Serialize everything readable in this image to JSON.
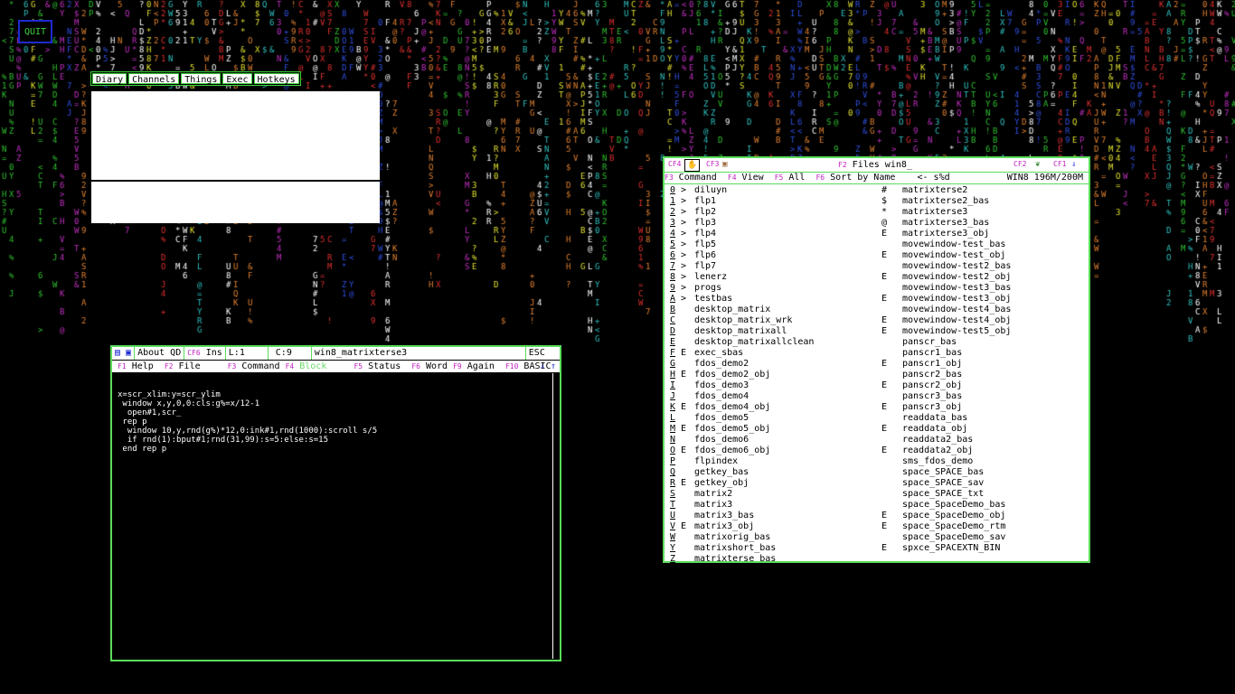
{
  "quit_label": "QUIT",
  "qd_menu": [
    "Diary",
    "Channels",
    "Things",
    "Exec",
    "Hotkeys"
  ],
  "editor": {
    "title": {
      "about": "About QD",
      "ins_key": "CF6",
      "ins": "Ins",
      "line": "L:1",
      "col": "C:9",
      "filename": "win8_matrixterse3",
      "esc": "ESC"
    },
    "fkeys": [
      {
        "key": "F1",
        "label": "Help"
      },
      {
        "key": "F2",
        "label": "File"
      },
      {
        "key": "F3",
        "label": "Command"
      },
      {
        "key": "F4",
        "label": "Block"
      },
      {
        "key": "F5",
        "label": "Status"
      },
      {
        "key": "F6",
        "label": "Word"
      },
      {
        "key": "F9",
        "label": "Again"
      },
      {
        "key": "F10",
        "label": "BASIC"
      }
    ],
    "code": [
      "x=scr_xlim:y=scr_ylim",
      " window x,y,0,0:cls:g%=x/12-1",
      "  open#1,scr_",
      "",
      " rep p",
      "  window 10,y,rnd(g%)*12,0:ink#1,rnd(1000):scroll s/5",
      "  if rnd(1):bput#1;rnd(31,99):s=5:else:s=15",
      " end rep p"
    ]
  },
  "files": {
    "title_key": "F2",
    "title": "Files win8_",
    "cf_left": [
      "CF4",
      "CF3"
    ],
    "cf_right": [
      "CF2",
      "CF1"
    ],
    "menu": [
      {
        "key": "F3",
        "label": "Command"
      },
      {
        "key": "F4",
        "label": "View"
      },
      {
        "key": "F5",
        "label": "All"
      },
      {
        "key": "F6",
        "label": "Sort by Name"
      }
    ],
    "path_hint": "<- s%d",
    "device": "WIN8 196M/200M",
    "left": [
      {
        "k": "0",
        "m": ">",
        "n": "diluyn"
      },
      {
        "k": "1",
        "m": ">",
        "n": "flp1"
      },
      {
        "k": "2",
        "m": ">",
        "n": "flp2"
      },
      {
        "k": "3",
        "m": ">",
        "n": "flp3"
      },
      {
        "k": "4",
        "m": ">",
        "n": "flp4"
      },
      {
        "k": "5",
        "m": ">",
        "n": "flp5"
      },
      {
        "k": "6",
        "m": ">",
        "n": "flp6"
      },
      {
        "k": "7",
        "m": ">",
        "n": "flp7"
      },
      {
        "k": "8",
        "m": ">",
        "n": "lenerz"
      },
      {
        "k": "9",
        "m": ">",
        "n": "progs"
      },
      {
        "k": "A",
        "m": ">",
        "n": "testbas"
      },
      {
        "k": "B",
        "m": "",
        "n": "desktop_matrix"
      },
      {
        "k": "C",
        "m": "",
        "n": "desktop_matrix_wrk"
      },
      {
        "k": "D",
        "m": "",
        "n": "desktop_matrixall"
      },
      {
        "k": "E",
        "m": "",
        "n": "desktop_matrixallclean"
      },
      {
        "k": "F",
        "m": "E",
        "n": "exec_sbas"
      },
      {
        "k": "G",
        "m": "",
        "n": "fdos_demo2"
      },
      {
        "k": "H",
        "m": "E",
        "n": "fdos_demo2_obj"
      },
      {
        "k": "I",
        "m": "",
        "n": "fdos_demo3"
      },
      {
        "k": "J",
        "m": "",
        "n": "fdos_demo4"
      },
      {
        "k": "K",
        "m": "E",
        "n": "fdos_demo4_obj"
      },
      {
        "k": "L",
        "m": "",
        "n": "fdos_demo5"
      },
      {
        "k": "M",
        "m": "E",
        "n": "fdos_demo5_obj"
      },
      {
        "k": "N",
        "m": "",
        "n": "fdos_demo6"
      },
      {
        "k": "O",
        "m": "E",
        "n": "fdos_demo6_obj"
      },
      {
        "k": "P",
        "m": "",
        "n": "flpindex"
      },
      {
        "k": "Q",
        "m": "",
        "n": "getkey_bas"
      },
      {
        "k": "R",
        "m": "E",
        "n": "getkey_obj"
      },
      {
        "k": "S",
        "m": "",
        "n": "matrix2"
      },
      {
        "k": "T",
        "m": "",
        "n": "matrix3"
      },
      {
        "k": "U",
        "m": "",
        "n": "matrix3_bas"
      },
      {
        "k": "V",
        "m": "E",
        "n": "matrix3_obj"
      },
      {
        "k": "W",
        "m": "",
        "n": "matrixorig_bas"
      },
      {
        "k": "Y",
        "m": "",
        "n": "matrixshort_bas"
      },
      {
        "k": "Z",
        "m": "",
        "n": "matrixterse_bas"
      }
    ],
    "right": [
      {
        "k": "#",
        "n": "matrixterse2"
      },
      {
        "k": "$",
        "n": "matrixterse2_bas"
      },
      {
        "k": "*",
        "n": "matrixterse3"
      },
      {
        "k": "@",
        "n": "matrixterse3_bas"
      },
      {
        "k": "E",
        "n": "matrixterse3_obj"
      },
      {
        "k": "",
        "n": "movewindow-test_bas"
      },
      {
        "k": "E",
        "n": "movewindow-test_obj"
      },
      {
        "k": "",
        "n": "movewindow-test2_bas"
      },
      {
        "k": "E",
        "n": "movewindow-test2_obj"
      },
      {
        "k": "",
        "n": "movewindow-test3_bas"
      },
      {
        "k": "E",
        "n": "movewindow-test3_obj"
      },
      {
        "k": "",
        "n": "movewindow-test4_bas"
      },
      {
        "k": "E",
        "n": "movewindow-test4_obj"
      },
      {
        "k": "E",
        "n": "movewindow-test5_obj"
      },
      {
        "k": "",
        "n": "panscr_bas"
      },
      {
        "k": "",
        "n": "panscr1_bas"
      },
      {
        "k": "E",
        "n": "panscr1_obj"
      },
      {
        "k": "",
        "n": "panscr2_bas"
      },
      {
        "k": "E",
        "n": "panscr2_obj"
      },
      {
        "k": "",
        "n": "panscr3_bas"
      },
      {
        "k": "E",
        "n": "panscr3_obj"
      },
      {
        "k": "",
        "n": "readdata_bas"
      },
      {
        "k": "E",
        "n": "readdata_obj"
      },
      {
        "k": "",
        "n": "readdata2_bas"
      },
      {
        "k": "E",
        "n": "readdata2_obj"
      },
      {
        "k": "",
        "n": "sms_fdos_demo"
      },
      {
        "k": "",
        "n": "space_SPACE_bas"
      },
      {
        "k": "",
        "n": "space_SPACE_sav"
      },
      {
        "k": "",
        "n": "space_SPACE_txt"
      },
      {
        "k": "",
        "n": "space_SpaceDemo_bas"
      },
      {
        "k": "E",
        "n": "space_SpaceDemo_obj"
      },
      {
        "k": "E",
        "n": "space_SpaceDemo_rtm"
      },
      {
        "k": "",
        "n": "space_SpaceDemo_sav"
      },
      {
        "k": "E",
        "n": "spxce_SPACEXTN_BIN"
      }
    ]
  },
  "colors": {
    "accent": "#5adc5a",
    "fkey": "#c020c0",
    "icon_blue": "#1e2ad0"
  }
}
